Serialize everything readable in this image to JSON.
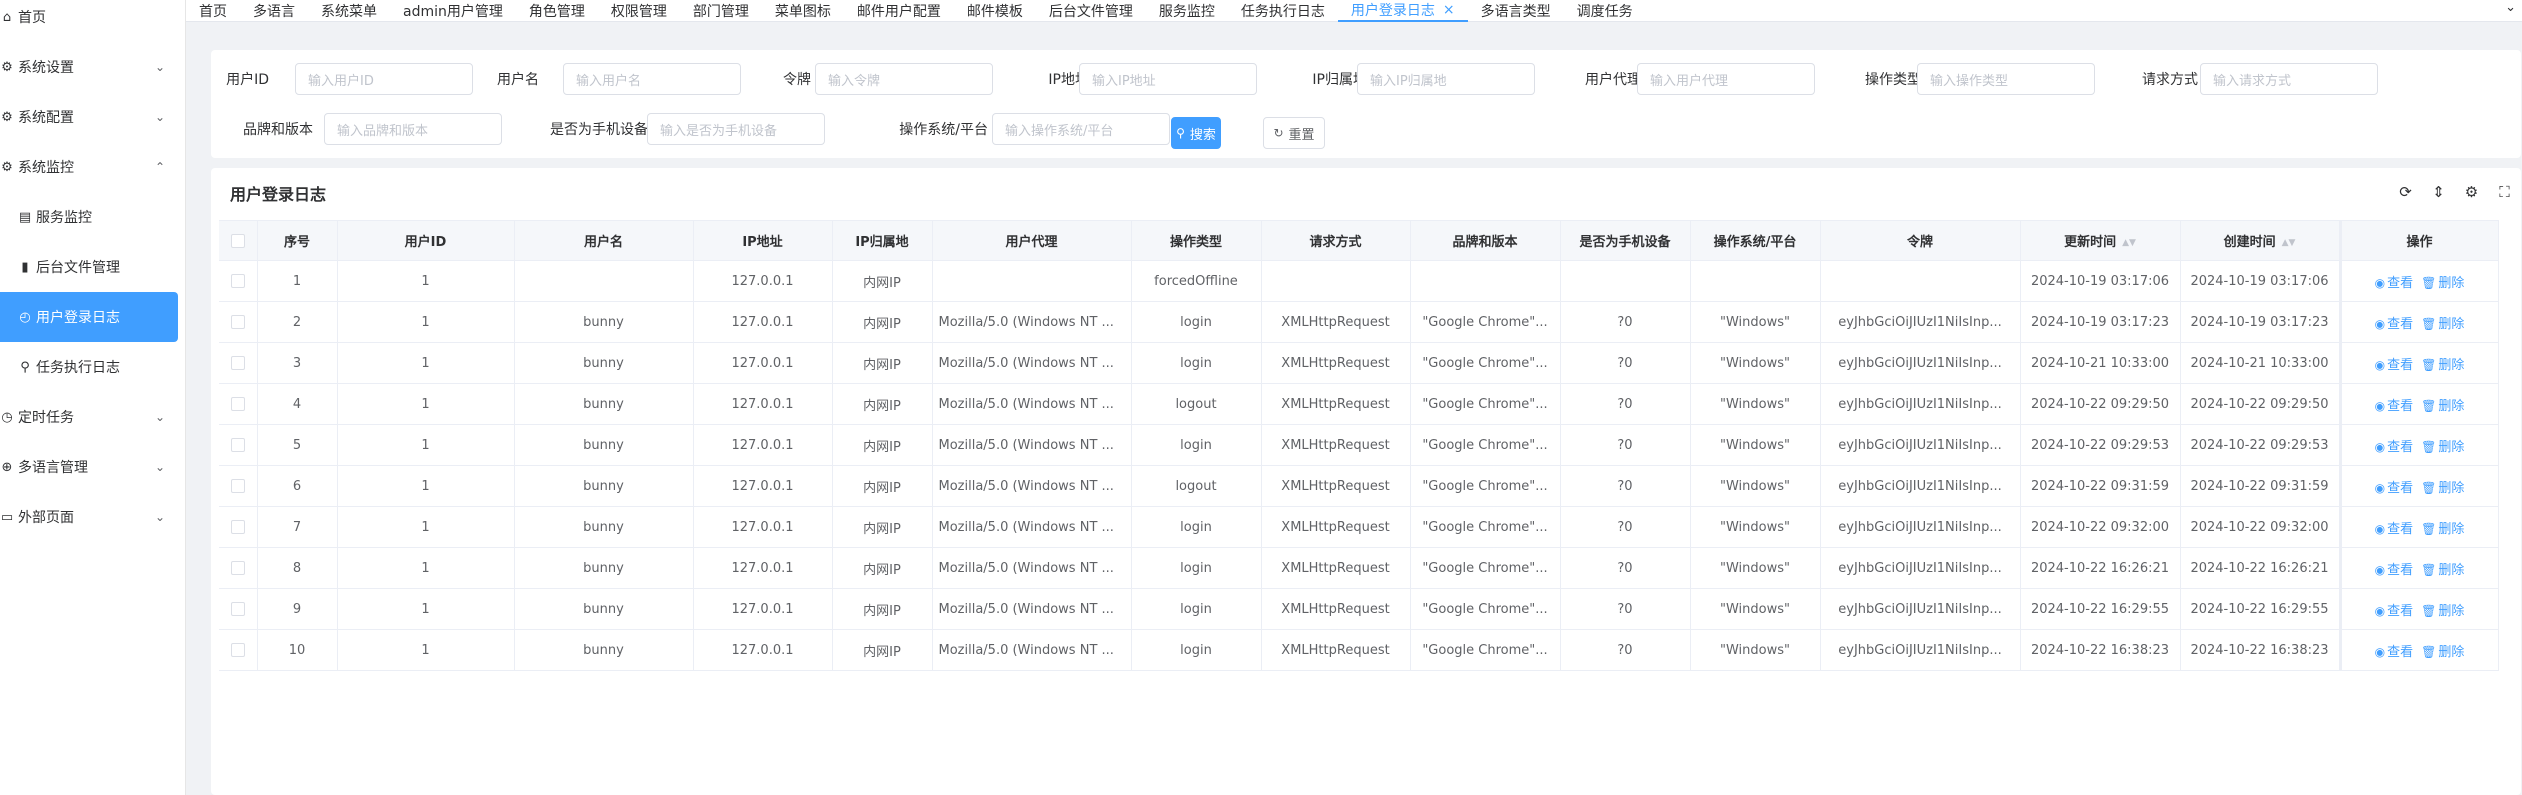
{
  "sidebar": {
    "items": [
      {
        "label": "首页",
        "icon": "home-icon",
        "glyph": "⌂",
        "level": 1,
        "chevron": ""
      },
      {
        "label": "系统设置",
        "icon": "settings-icon",
        "glyph": "⚙",
        "level": 1,
        "chevron": "⌄"
      },
      {
        "label": "系统配置",
        "icon": "config-icon",
        "glyph": "⚙",
        "level": 1,
        "chevron": "⌄"
      },
      {
        "label": "系统监控",
        "icon": "monitor-icon",
        "glyph": "⚙",
        "level": 1,
        "chevron": "⌃"
      },
      {
        "label": "服务监控",
        "icon": "server-icon",
        "glyph": "▤",
        "level": 2,
        "chevron": ""
      },
      {
        "label": "后台文件管理",
        "icon": "file-icon",
        "glyph": "▮",
        "level": 2,
        "chevron": ""
      },
      {
        "label": "用户登录日志",
        "icon": "login-log-icon",
        "glyph": "◴",
        "level": 2,
        "chevron": "",
        "active": true
      },
      {
        "label": "任务执行日志",
        "icon": "task-log-icon",
        "glyph": "⚲",
        "level": 2,
        "chevron": ""
      },
      {
        "label": "定时任务",
        "icon": "clock-icon",
        "glyph": "◷",
        "level": 1,
        "chevron": "⌄"
      },
      {
        "label": "多语言管理",
        "icon": "globe-icon",
        "glyph": "⊕",
        "level": 1,
        "chevron": "⌄"
      },
      {
        "label": "外部页面",
        "icon": "window-icon",
        "glyph": "▭",
        "level": 1,
        "chevron": "⌄"
      }
    ]
  },
  "tabs": [
    {
      "label": "首页"
    },
    {
      "label": "多语言"
    },
    {
      "label": "系统菜单"
    },
    {
      "label": "admin用户管理"
    },
    {
      "label": "角色管理"
    },
    {
      "label": "权限管理"
    },
    {
      "label": "部门管理"
    },
    {
      "label": "菜单图标"
    },
    {
      "label": "邮件用户配置"
    },
    {
      "label": "邮件模板"
    },
    {
      "label": "后台文件管理"
    },
    {
      "label": "服务监控"
    },
    {
      "label": "任务执行日志"
    },
    {
      "label": "用户登录日志",
      "active": true,
      "close": "×"
    },
    {
      "label": "多语言类型"
    },
    {
      "label": "调度任务"
    }
  ],
  "tabs_more": "⌄",
  "filters": {
    "row1": [
      {
        "label": "用户ID",
        "placeholder": "输入用户ID"
      },
      {
        "label": "用户名",
        "placeholder": "输入用户名"
      },
      {
        "label": "令牌",
        "placeholder": "输入令牌"
      },
      {
        "label": "IP地址",
        "placeholder": "输入IP地址"
      },
      {
        "label": "IP归属地",
        "placeholder": "输入IP归属地"
      },
      {
        "label": "用户代理",
        "placeholder": "输入用户代理"
      },
      {
        "label": "操作类型",
        "placeholder": "输入操作类型"
      },
      {
        "label": "请求方式",
        "placeholder": "输入请求方式"
      }
    ],
    "row2": [
      {
        "label": "品牌和版本",
        "placeholder": "输入品牌和版本"
      },
      {
        "label": "是否为手机设备",
        "placeholder": "输入是否为手机设备"
      },
      {
        "label": "操作系统/平台",
        "placeholder": "输入操作系统/平台"
      }
    ],
    "search_label": "搜索",
    "reset_label": "重置"
  },
  "table": {
    "title": "用户登录日志",
    "toolbar": [
      "refresh-icon",
      "column-height-icon",
      "settings-icon",
      "fullscreen-icon"
    ],
    "columns": [
      "",
      "序号",
      "用户ID",
      "用户名",
      "IP地址",
      "IP归属地",
      "用户代理",
      "操作类型",
      "请求方式",
      "品牌和版本",
      "是否为手机设备",
      "操作系统/平台",
      "令牌",
      "更新时间",
      "创建时间",
      "操作"
    ],
    "view_label": "查看",
    "delete_label": "删除",
    "rows": [
      [
        "1",
        "1",
        "",
        "127.0.0.1",
        "内网IP",
        "",
        "forcedOffline",
        "",
        "",
        "",
        "",
        "",
        "2024-10-19 03:17:06",
        "2024-10-19 03:17:06"
      ],
      [
        "2",
        "1",
        "bunny",
        "127.0.0.1",
        "内网IP",
        "Mozilla/5.0 (Windows NT ...",
        "login",
        "XMLHttpRequest",
        "\"Google Chrome\"...",
        "?0",
        "\"Windows\"",
        "eyJhbGciOiJIUzI1NiIsInp...",
        "2024-10-19 03:17:23",
        "2024-10-19 03:17:23"
      ],
      [
        "3",
        "1",
        "bunny",
        "127.0.0.1",
        "内网IP",
        "Mozilla/5.0 (Windows NT ...",
        "login",
        "XMLHttpRequest",
        "\"Google Chrome\"...",
        "?0",
        "\"Windows\"",
        "eyJhbGciOiJIUzI1NiIsInp...",
        "2024-10-21 10:33:00",
        "2024-10-21 10:33:00"
      ],
      [
        "4",
        "1",
        "bunny",
        "127.0.0.1",
        "内网IP",
        "Mozilla/5.0 (Windows NT ...",
        "logout",
        "XMLHttpRequest",
        "\"Google Chrome\"...",
        "?0",
        "\"Windows\"",
        "eyJhbGciOiJIUzI1NiIsInp...",
        "2024-10-22 09:29:50",
        "2024-10-22 09:29:50"
      ],
      [
        "5",
        "1",
        "bunny",
        "127.0.0.1",
        "内网IP",
        "Mozilla/5.0 (Windows NT ...",
        "login",
        "XMLHttpRequest",
        "\"Google Chrome\"...",
        "?0",
        "\"Windows\"",
        "eyJhbGciOiJIUzI1NiIsInp...",
        "2024-10-22 09:29:53",
        "2024-10-22 09:29:53"
      ],
      [
        "6",
        "1",
        "bunny",
        "127.0.0.1",
        "内网IP",
        "Mozilla/5.0 (Windows NT ...",
        "logout",
        "XMLHttpRequest",
        "\"Google Chrome\"...",
        "?0",
        "\"Windows\"",
        "eyJhbGciOiJIUzI1NiIsInp...",
        "2024-10-22 09:31:59",
        "2024-10-22 09:31:59"
      ],
      [
        "7",
        "1",
        "bunny",
        "127.0.0.1",
        "内网IP",
        "Mozilla/5.0 (Windows NT ...",
        "login",
        "XMLHttpRequest",
        "\"Google Chrome\"...",
        "?0",
        "\"Windows\"",
        "eyJhbGciOiJIUzI1NiIsInp...",
        "2024-10-22 09:32:00",
        "2024-10-22 09:32:00"
      ],
      [
        "8",
        "1",
        "bunny",
        "127.0.0.1",
        "内网IP",
        "Mozilla/5.0 (Windows NT ...",
        "login",
        "XMLHttpRequest",
        "\"Google Chrome\"...",
        "?0",
        "\"Windows\"",
        "eyJhbGciOiJIUzI1NiIsInp...",
        "2024-10-22 16:26:21",
        "2024-10-22 16:26:21"
      ],
      [
        "9",
        "1",
        "bunny",
        "127.0.0.1",
        "内网IP",
        "Mozilla/5.0 (Windows NT ...",
        "login",
        "XMLHttpRequest",
        "\"Google Chrome\"...",
        "?0",
        "\"Windows\"",
        "eyJhbGciOiJIUzI1NiIsInp...",
        "2024-10-22 16:29:55",
        "2024-10-22 16:29:55"
      ],
      [
        "10",
        "1",
        "bunny",
        "127.0.0.1",
        "内网IP",
        "Mozilla/5.0 (Windows NT ...",
        "login",
        "XMLHttpRequest",
        "\"Google Chrome\"...",
        "?0",
        "\"Windows\"",
        "eyJhbGciOiJIUzI1NiIsInp...",
        "2024-10-22 16:38:23",
        "2024-10-22 16:38:23"
      ]
    ]
  },
  "colors": {
    "accent": "#409eff",
    "border": "#ebeef5",
    "header_bg": "#f5f7fa"
  }
}
